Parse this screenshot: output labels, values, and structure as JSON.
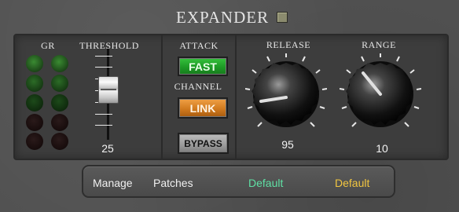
{
  "header": {
    "title": "EXPANDER"
  },
  "sections": {
    "gr_label": "GR",
    "threshold_label": "THRESHOLD",
    "attack_label": "ATTACK",
    "channel_label": "CHANNEL",
    "release_label": "RELEASE",
    "range_label": "RANGE"
  },
  "gr_meter": {
    "lit_rows": 3,
    "total_rows": 5
  },
  "threshold": {
    "value": "25"
  },
  "buttons": {
    "fast": "FAST",
    "link": "LINK",
    "bypass": "BYPASS"
  },
  "release": {
    "value": "95"
  },
  "range": {
    "value": "10"
  },
  "patches": {
    "manage": "Manage",
    "patches": "Patches",
    "preset_a": "Default",
    "preset_b": "Default"
  },
  "colors": {
    "fast_button": "#1e9a26",
    "link_button": "#d17a1e",
    "preset_a": "#5fe0a4",
    "preset_b": "#f2c640"
  }
}
